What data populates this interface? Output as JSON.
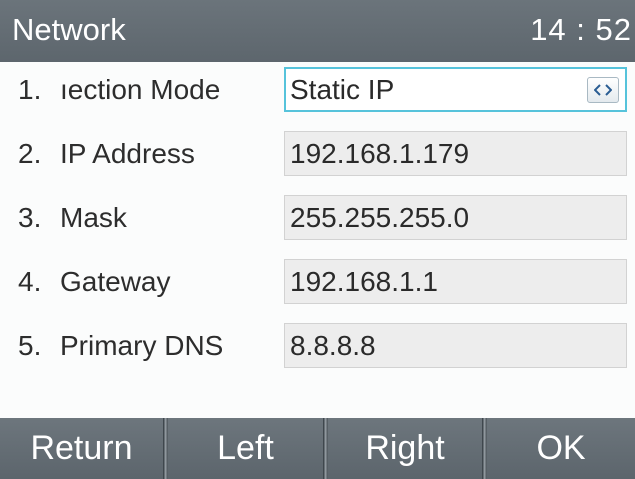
{
  "header": {
    "title": "Network",
    "time": "14 : 52"
  },
  "rows": [
    {
      "number": "1.",
      "label": "ıection Mode",
      "value": "Static IP"
    },
    {
      "number": "2.",
      "label": "IP Address",
      "value": "192.168.1.179"
    },
    {
      "number": "3.",
      "label": "Mask",
      "value": "255.255.255.0"
    },
    {
      "number": "4.",
      "label": "Gateway",
      "value": "192.168.1.1"
    },
    {
      "number": "5.",
      "label": "Primary  DNS",
      "value": "8.8.8.8"
    }
  ],
  "softkeys": {
    "return": "Return",
    "left": "Left",
    "right": "Right",
    "ok": "OK"
  },
  "colors": {
    "header_bg": "#636c73",
    "selected_border": "#56c3db",
    "field_bg": "#ededed",
    "page_bg": "#fbfcfc"
  },
  "icons": {
    "mode_selector": "left-right-chevron-icon"
  }
}
